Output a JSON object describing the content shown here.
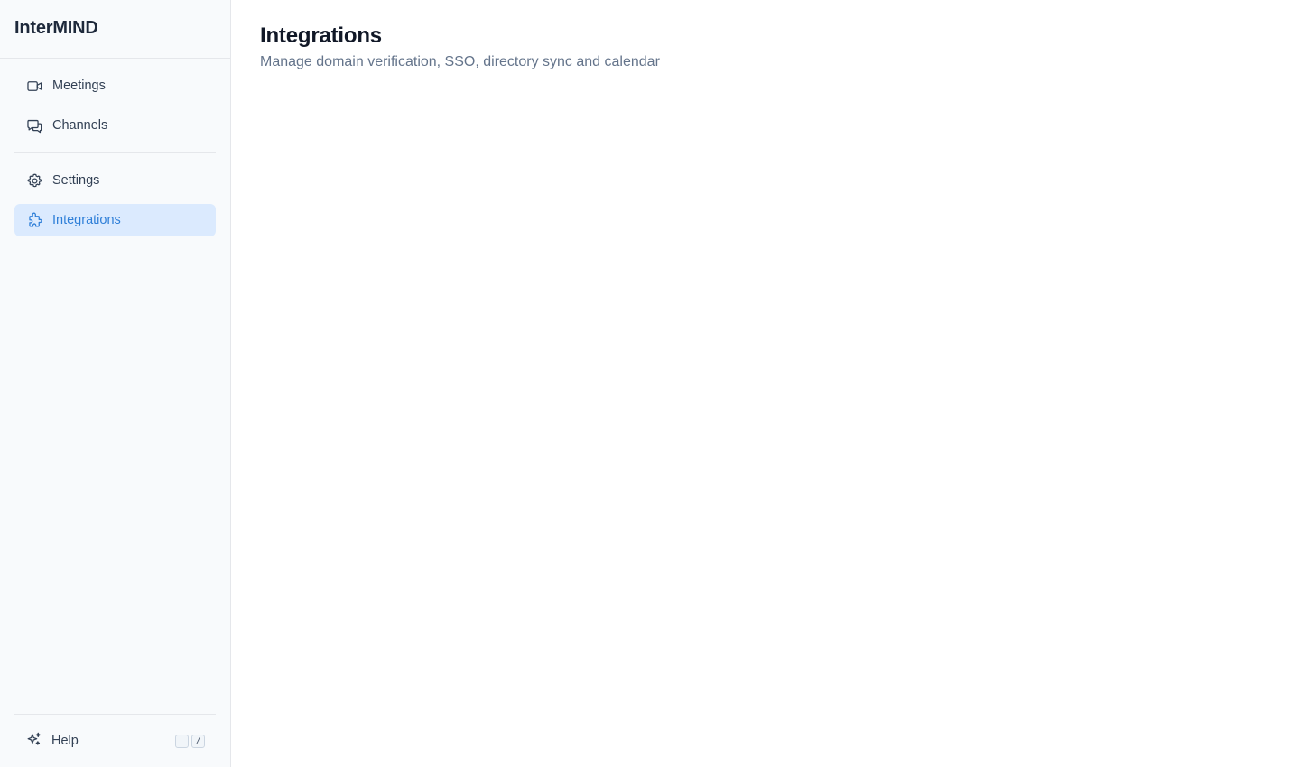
{
  "brand": {
    "name": "InterMIND"
  },
  "sidebar": {
    "primary": [
      {
        "label": "Meetings",
        "icon": "video-camera-icon"
      },
      {
        "label": "Channels",
        "icon": "chat-bubbles-icon"
      }
    ],
    "secondary": [
      {
        "label": "Settings",
        "icon": "gear-icon"
      },
      {
        "label": "Integrations",
        "icon": "puzzle-icon",
        "active": true
      }
    ],
    "footer": {
      "help_label": "Help",
      "help_icon": "sparkles-icon",
      "shortcut_keys": [
        "",
        "/"
      ]
    }
  },
  "main": {
    "title": "Integrations",
    "subtitle": "Manage domain verification, SSO, directory sync and calendar"
  },
  "colors": {
    "accent": "#2f7fd8",
    "active_bg": "#dbeafe",
    "sidebar_bg": "#f8fafc"
  }
}
